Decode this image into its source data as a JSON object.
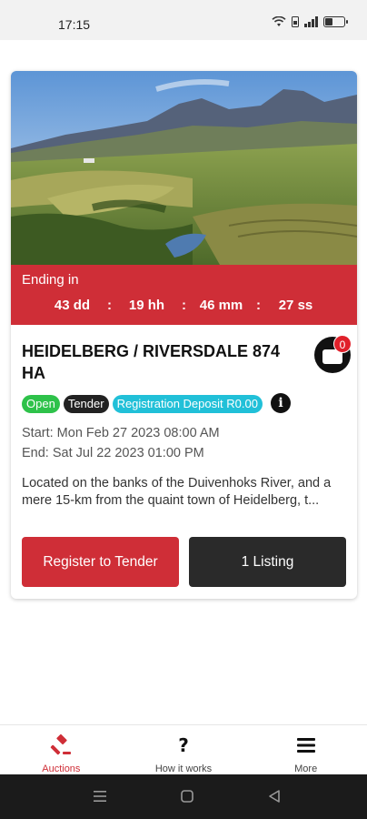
{
  "status_bar": {
    "time": "17:15",
    "icons": [
      "wifi-icon",
      "sim-icon",
      "signal-icon",
      "battery-icon"
    ]
  },
  "auction": {
    "image_description_icon": "landscape-photo",
    "countdown": {
      "label": "Ending in",
      "days": "43 dd",
      "hours": "19 hh",
      "minutes": "46 mm",
      "seconds": "27 ss",
      "separator": ":"
    },
    "title": "HEIDELBERG / RIVERSDALE 874 HA",
    "cart_count": "0",
    "badges": {
      "open": "Open",
      "tender": "Tender",
      "deposit": "Registration Deposit R0.00"
    },
    "start": "Start: Mon Feb 27 2023 08:00 AM",
    "end": "End: Sat Jul 22 2023 01:00 PM",
    "description": "Located on the banks of the Duivenhoks River, and a mere 15-km from the quaint town of Heidelberg, t...",
    "buttons": {
      "register": "Register to Tender",
      "listing": "1 Listing"
    }
  },
  "bottom_nav": {
    "items": [
      {
        "label": "Auctions",
        "icon": "gavel-icon",
        "active": true
      },
      {
        "label": "How it works",
        "icon": "question-icon",
        "active": false
      },
      {
        "label": "More",
        "icon": "menu-icon",
        "active": false
      }
    ]
  },
  "colors": {
    "accent": "#cf2e37",
    "dark": "#2a2a2a",
    "open_badge": "#2ec24a",
    "deposit_badge": "#21c0d8"
  }
}
